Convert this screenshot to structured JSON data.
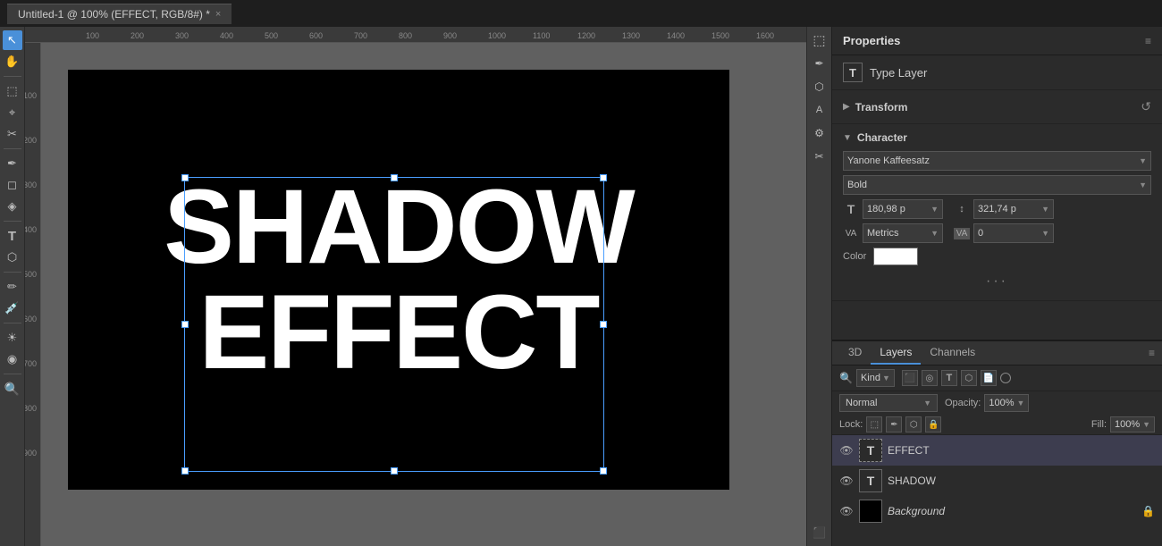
{
  "titlebar": {
    "tab_label": "Untitled-1 @ 100% (EFFECT, RGB/8#) *",
    "close_label": "×"
  },
  "properties": {
    "title": "Properties",
    "menu_icon": "≡",
    "type_layer_label": "Type Layer",
    "transform_label": "Transform",
    "reset_icon": "↺",
    "character_label": "Character",
    "font_family": "Yanone Kaffeesatz",
    "font_style": "Bold",
    "font_size": "180,98 p",
    "leading": "321,74 p",
    "kerning_label": "Metrics",
    "tracking_value": "0",
    "color_label": "Color",
    "more_dots": "···"
  },
  "layers": {
    "tab_3d": "3D",
    "tab_layers": "Layers",
    "tab_channels": "Channels",
    "search_kind": "Kind",
    "blend_mode": "Normal",
    "opacity_label": "Opacity:",
    "opacity_value": "100%",
    "lock_label": "Lock:",
    "fill_label": "Fill:",
    "fill_value": "100%",
    "layer_items": [
      {
        "name": "EFFECT",
        "type": "text_dashed",
        "visible": true,
        "selected": true
      },
      {
        "name": "SHADOW",
        "type": "text",
        "visible": true,
        "selected": false
      },
      {
        "name": "Background",
        "type": "black",
        "visible": true,
        "selected": false,
        "italic": true,
        "locked": true
      }
    ]
  },
  "canvas": {
    "line1": "SHADOW",
    "line2": "EFFECT"
  },
  "ruler": {
    "h_marks": [
      "100",
      "200",
      "300",
      "400",
      "500",
      "600",
      "700",
      "800",
      "900",
      "1000",
      "1100",
      "1200",
      "1300",
      "1400",
      "1500",
      "1600"
    ],
    "v_marks": [
      "100",
      "200",
      "300",
      "400",
      "500",
      "600",
      "700",
      "800",
      "900"
    ]
  },
  "tools": [
    "↖",
    "✋",
    "↔",
    "⬚",
    "⌖",
    "✂",
    "✒",
    "⬡",
    "T",
    "🔲",
    "A",
    "⬛",
    "↪",
    "⚙"
  ]
}
